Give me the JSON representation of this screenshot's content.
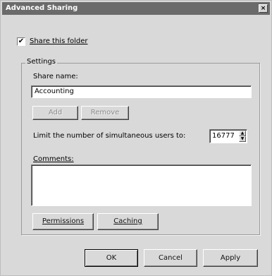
{
  "window": {
    "title": "Advanced Sharing",
    "close_label": "×"
  },
  "share": {
    "checkbox_checked": true,
    "check_mark": "✔",
    "label": "Share this folder"
  },
  "settings": {
    "legend": "Settings",
    "share_name_label": "Share name:",
    "share_name_value": "Accounting",
    "add_label": "Add",
    "remove_label": "Remove",
    "limit_label": "Limit the number of simultaneous users to:",
    "limit_value": "16777",
    "comments_label": "Comments:",
    "comments_value": ""
  },
  "buttons": {
    "permissions": "Permissions",
    "caching": "Caching",
    "ok": "OK",
    "cancel": "Cancel",
    "apply": "Apply"
  }
}
